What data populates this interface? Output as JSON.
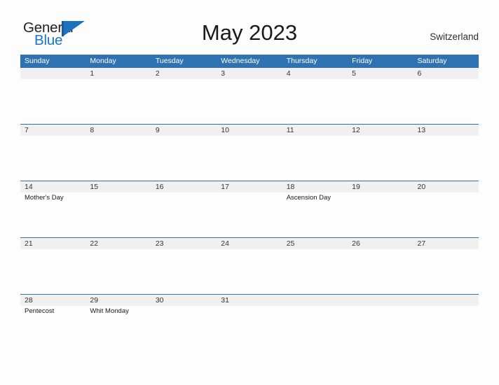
{
  "brand": {
    "name_part1": "General",
    "name_part2": "Blue",
    "mark": "triangle-flag-icon",
    "color_dark": "#231f20",
    "color_blue": "#1877c9"
  },
  "header": {
    "title": "May 2023",
    "country": "Switzerland"
  },
  "theme": {
    "header_blue": "#2e72b2",
    "date_band_gray": "#f0f0f0",
    "page_background": "#fdfdfd",
    "text_dark": "#1a1a1a"
  },
  "calendar": {
    "weekdays": [
      "Sunday",
      "Monday",
      "Tuesday",
      "Wednesday",
      "Thursday",
      "Friday",
      "Saturday"
    ],
    "weeks": [
      [
        {
          "day": "",
          "event": ""
        },
        {
          "day": "1",
          "event": ""
        },
        {
          "day": "2",
          "event": ""
        },
        {
          "day": "3",
          "event": ""
        },
        {
          "day": "4",
          "event": ""
        },
        {
          "day": "5",
          "event": ""
        },
        {
          "day": "6",
          "event": ""
        }
      ],
      [
        {
          "day": "7",
          "event": ""
        },
        {
          "day": "8",
          "event": ""
        },
        {
          "day": "9",
          "event": ""
        },
        {
          "day": "10",
          "event": ""
        },
        {
          "day": "11",
          "event": ""
        },
        {
          "day": "12",
          "event": ""
        },
        {
          "day": "13",
          "event": ""
        }
      ],
      [
        {
          "day": "14",
          "event": "Mother's Day"
        },
        {
          "day": "15",
          "event": ""
        },
        {
          "day": "16",
          "event": ""
        },
        {
          "day": "17",
          "event": ""
        },
        {
          "day": "18",
          "event": "Ascension Day"
        },
        {
          "day": "19",
          "event": ""
        },
        {
          "day": "20",
          "event": ""
        }
      ],
      [
        {
          "day": "21",
          "event": ""
        },
        {
          "day": "22",
          "event": ""
        },
        {
          "day": "23",
          "event": ""
        },
        {
          "day": "24",
          "event": ""
        },
        {
          "day": "25",
          "event": ""
        },
        {
          "day": "26",
          "event": ""
        },
        {
          "day": "27",
          "event": ""
        }
      ],
      [
        {
          "day": "28",
          "event": "Pentecost"
        },
        {
          "day": "29",
          "event": "Whit Monday"
        },
        {
          "day": "30",
          "event": ""
        },
        {
          "day": "31",
          "event": ""
        },
        {
          "day": "",
          "event": ""
        },
        {
          "day": "",
          "event": ""
        },
        {
          "day": "",
          "event": ""
        }
      ]
    ]
  }
}
